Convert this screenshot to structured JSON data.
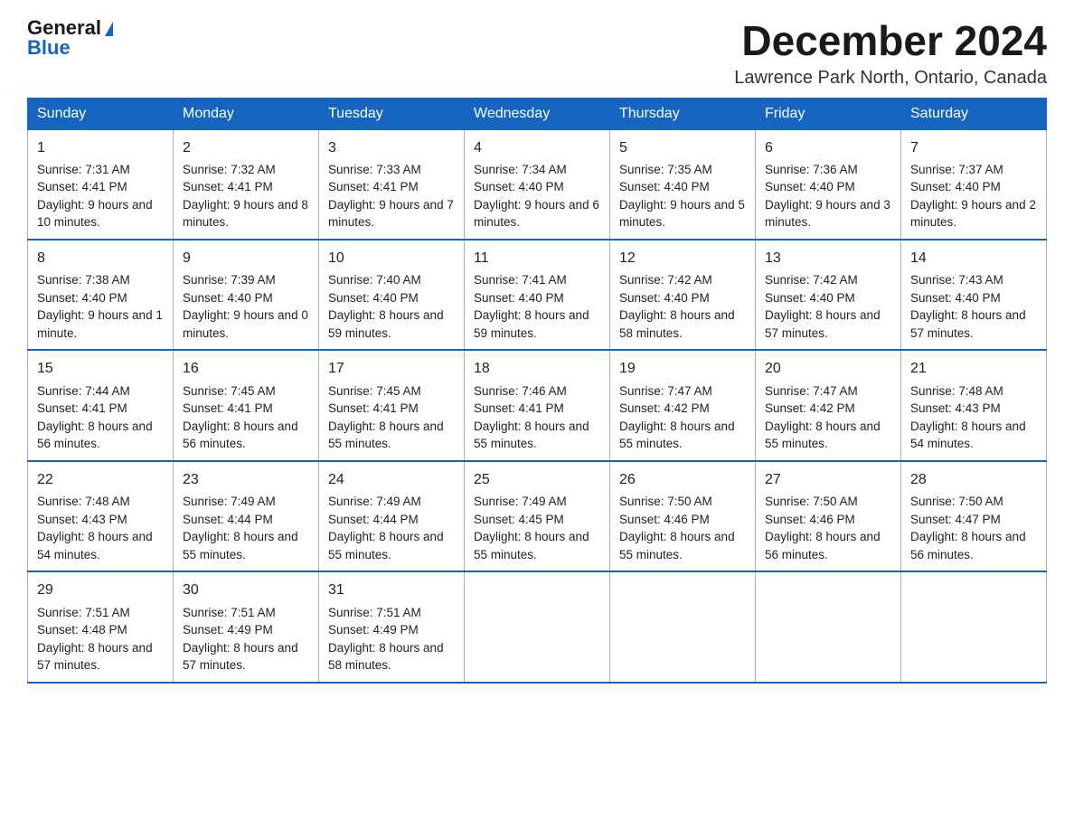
{
  "header": {
    "logo_general": "General",
    "logo_blue": "Blue",
    "month_title": "December 2024",
    "location": "Lawrence Park North, Ontario, Canada"
  },
  "days_of_week": [
    "Sunday",
    "Monday",
    "Tuesday",
    "Wednesday",
    "Thursday",
    "Friday",
    "Saturday"
  ],
  "weeks": [
    [
      {
        "day": "1",
        "sunrise": "Sunrise: 7:31 AM",
        "sunset": "Sunset: 4:41 PM",
        "daylight": "Daylight: 9 hours and 10 minutes."
      },
      {
        "day": "2",
        "sunrise": "Sunrise: 7:32 AM",
        "sunset": "Sunset: 4:41 PM",
        "daylight": "Daylight: 9 hours and 8 minutes."
      },
      {
        "day": "3",
        "sunrise": "Sunrise: 7:33 AM",
        "sunset": "Sunset: 4:41 PM",
        "daylight": "Daylight: 9 hours and 7 minutes."
      },
      {
        "day": "4",
        "sunrise": "Sunrise: 7:34 AM",
        "sunset": "Sunset: 4:40 PM",
        "daylight": "Daylight: 9 hours and 6 minutes."
      },
      {
        "day": "5",
        "sunrise": "Sunrise: 7:35 AM",
        "sunset": "Sunset: 4:40 PM",
        "daylight": "Daylight: 9 hours and 5 minutes."
      },
      {
        "day": "6",
        "sunrise": "Sunrise: 7:36 AM",
        "sunset": "Sunset: 4:40 PM",
        "daylight": "Daylight: 9 hours and 3 minutes."
      },
      {
        "day": "7",
        "sunrise": "Sunrise: 7:37 AM",
        "sunset": "Sunset: 4:40 PM",
        "daylight": "Daylight: 9 hours and 2 minutes."
      }
    ],
    [
      {
        "day": "8",
        "sunrise": "Sunrise: 7:38 AM",
        "sunset": "Sunset: 4:40 PM",
        "daylight": "Daylight: 9 hours and 1 minute."
      },
      {
        "day": "9",
        "sunrise": "Sunrise: 7:39 AM",
        "sunset": "Sunset: 4:40 PM",
        "daylight": "Daylight: 9 hours and 0 minutes."
      },
      {
        "day": "10",
        "sunrise": "Sunrise: 7:40 AM",
        "sunset": "Sunset: 4:40 PM",
        "daylight": "Daylight: 8 hours and 59 minutes."
      },
      {
        "day": "11",
        "sunrise": "Sunrise: 7:41 AM",
        "sunset": "Sunset: 4:40 PM",
        "daylight": "Daylight: 8 hours and 59 minutes."
      },
      {
        "day": "12",
        "sunrise": "Sunrise: 7:42 AM",
        "sunset": "Sunset: 4:40 PM",
        "daylight": "Daylight: 8 hours and 58 minutes."
      },
      {
        "day": "13",
        "sunrise": "Sunrise: 7:42 AM",
        "sunset": "Sunset: 4:40 PM",
        "daylight": "Daylight: 8 hours and 57 minutes."
      },
      {
        "day": "14",
        "sunrise": "Sunrise: 7:43 AM",
        "sunset": "Sunset: 4:40 PM",
        "daylight": "Daylight: 8 hours and 57 minutes."
      }
    ],
    [
      {
        "day": "15",
        "sunrise": "Sunrise: 7:44 AM",
        "sunset": "Sunset: 4:41 PM",
        "daylight": "Daylight: 8 hours and 56 minutes."
      },
      {
        "day": "16",
        "sunrise": "Sunrise: 7:45 AM",
        "sunset": "Sunset: 4:41 PM",
        "daylight": "Daylight: 8 hours and 56 minutes."
      },
      {
        "day": "17",
        "sunrise": "Sunrise: 7:45 AM",
        "sunset": "Sunset: 4:41 PM",
        "daylight": "Daylight: 8 hours and 55 minutes."
      },
      {
        "day": "18",
        "sunrise": "Sunrise: 7:46 AM",
        "sunset": "Sunset: 4:41 PM",
        "daylight": "Daylight: 8 hours and 55 minutes."
      },
      {
        "day": "19",
        "sunrise": "Sunrise: 7:47 AM",
        "sunset": "Sunset: 4:42 PM",
        "daylight": "Daylight: 8 hours and 55 minutes."
      },
      {
        "day": "20",
        "sunrise": "Sunrise: 7:47 AM",
        "sunset": "Sunset: 4:42 PM",
        "daylight": "Daylight: 8 hours and 55 minutes."
      },
      {
        "day": "21",
        "sunrise": "Sunrise: 7:48 AM",
        "sunset": "Sunset: 4:43 PM",
        "daylight": "Daylight: 8 hours and 54 minutes."
      }
    ],
    [
      {
        "day": "22",
        "sunrise": "Sunrise: 7:48 AM",
        "sunset": "Sunset: 4:43 PM",
        "daylight": "Daylight: 8 hours and 54 minutes."
      },
      {
        "day": "23",
        "sunrise": "Sunrise: 7:49 AM",
        "sunset": "Sunset: 4:44 PM",
        "daylight": "Daylight: 8 hours and 55 minutes."
      },
      {
        "day": "24",
        "sunrise": "Sunrise: 7:49 AM",
        "sunset": "Sunset: 4:44 PM",
        "daylight": "Daylight: 8 hours and 55 minutes."
      },
      {
        "day": "25",
        "sunrise": "Sunrise: 7:49 AM",
        "sunset": "Sunset: 4:45 PM",
        "daylight": "Daylight: 8 hours and 55 minutes."
      },
      {
        "day": "26",
        "sunrise": "Sunrise: 7:50 AM",
        "sunset": "Sunset: 4:46 PM",
        "daylight": "Daylight: 8 hours and 55 minutes."
      },
      {
        "day": "27",
        "sunrise": "Sunrise: 7:50 AM",
        "sunset": "Sunset: 4:46 PM",
        "daylight": "Daylight: 8 hours and 56 minutes."
      },
      {
        "day": "28",
        "sunrise": "Sunrise: 7:50 AM",
        "sunset": "Sunset: 4:47 PM",
        "daylight": "Daylight: 8 hours and 56 minutes."
      }
    ],
    [
      {
        "day": "29",
        "sunrise": "Sunrise: 7:51 AM",
        "sunset": "Sunset: 4:48 PM",
        "daylight": "Daylight: 8 hours and 57 minutes."
      },
      {
        "day": "30",
        "sunrise": "Sunrise: 7:51 AM",
        "sunset": "Sunset: 4:49 PM",
        "daylight": "Daylight: 8 hours and 57 minutes."
      },
      {
        "day": "31",
        "sunrise": "Sunrise: 7:51 AM",
        "sunset": "Sunset: 4:49 PM",
        "daylight": "Daylight: 8 hours and 58 minutes."
      },
      null,
      null,
      null,
      null
    ]
  ]
}
